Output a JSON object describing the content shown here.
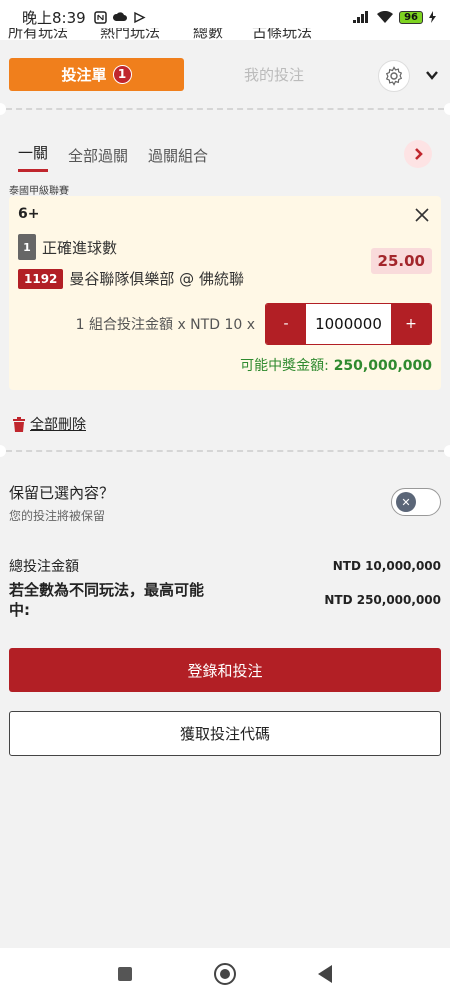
{
  "status_bar": {
    "time": "晚上8:39",
    "icons": [
      "nfc-icon",
      "cloud-icon",
      "cast-icon"
    ],
    "right_icons": [
      "signal-icon",
      "wifi-icon"
    ],
    "battery": "96"
  },
  "cut_tabs": [
    "所有玩法",
    "熱門玩法",
    "總數",
    "古條玩法"
  ],
  "betslip": {
    "tab_label": "投注單",
    "count": "1",
    "my_bets_label": "我的投注"
  },
  "sub_tabs": [
    "一關",
    "全部過關",
    "過關組合"
  ],
  "league": "泰國甲級聯賽",
  "bet": {
    "selection": "6+",
    "market_index": "1",
    "market_name": "正確進球數",
    "odds": "25.00",
    "match_code": "1192",
    "match_name": "曼谷聯隊俱樂部 @ 佛統聯",
    "stake_label": "1 組合投注金額 x NTD 10 x",
    "minus": "-",
    "plus": "+",
    "stake_value": "1000000",
    "payout_label": "可能中獎金額:",
    "payout_value": "250,000,000"
  },
  "delete_all": "全部刪除",
  "keep": {
    "title": "保留已選內容？",
    "subtitle": "您的投注將被保留"
  },
  "totals": {
    "total_label": "總投注金額",
    "total_value": "NTD 10,000,000",
    "max_label": "若全數為不同玩法，最高可能中:",
    "max_value": "NTD 250,000,000"
  },
  "buttons": {
    "submit": "登錄和投注",
    "code": "獲取投注代碼"
  },
  "colors": {
    "accent_orange": "#f07f1c",
    "accent_red": "#b21f25",
    "payout_green": "#2f8a2f"
  }
}
